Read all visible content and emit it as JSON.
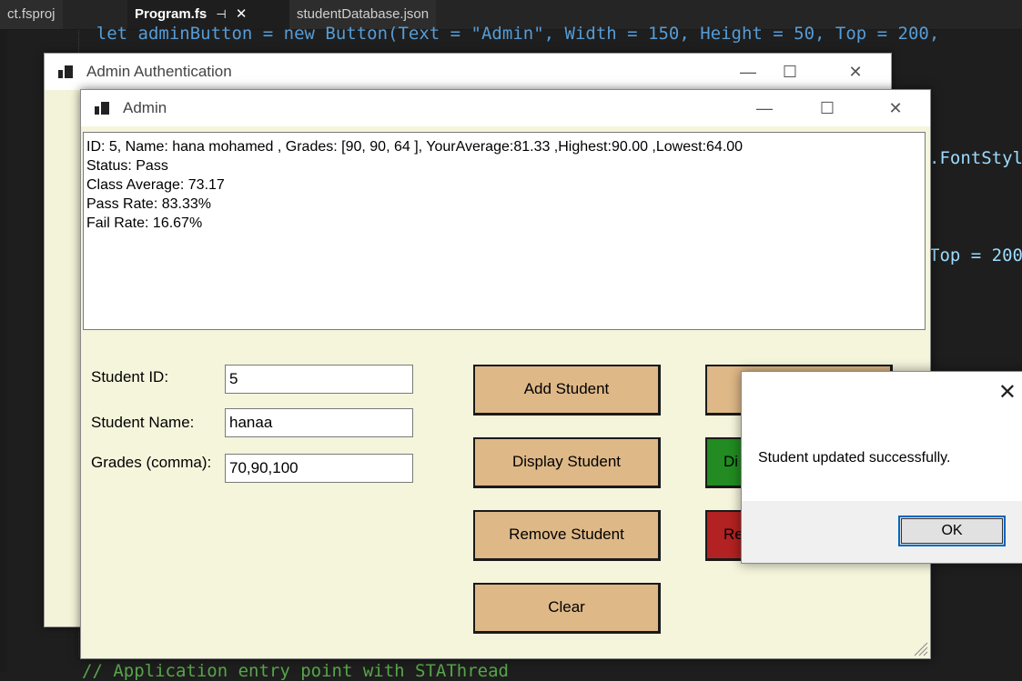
{
  "editor": {
    "tabs": [
      {
        "label": "ct.fsproj"
      },
      {
        "label": "Program.fs",
        "pin": "⊣",
        "close": "✕"
      },
      {
        "label": "studentDatabase.json"
      }
    ],
    "code_top": "    let adminButton = new Button(Text = \"Admin\", Width = 150, Height = 50, Top = 200,",
    "code_right_1": ".FontStyl",
    "code_right_2": "Top = 200",
    "code_bottom": "// Application entry point with STAThread"
  },
  "auth_window": {
    "title": "Admin Authentication",
    "minimize": "—",
    "maximize": "☐",
    "close": "✕"
  },
  "admin_window": {
    "title": "Admin",
    "minimize": "—",
    "maximize": "☐",
    "close": "✕",
    "output": "ID: 5, Name: hana mohamed , Grades: [90, 90, 64 ], YourAverage:81.33 ,Highest:90.00 ,Lowest:64.00\nStatus: Pass\nClass Average: 73.17\nPass Rate: 83.33%\nFail Rate: 16.67%",
    "labels": {
      "student_id": "Student ID:",
      "student_name": "Student Name:",
      "grades": "Grades (comma):"
    },
    "inputs": {
      "student_id": "5",
      "student_name": "hanaa",
      "grades": "70,90,100"
    },
    "buttons": {
      "add": "Add Student",
      "display": "Display Student",
      "remove": "Remove Student",
      "clear": "Clear",
      "green_partial": "Di",
      "red_partial": "Re"
    }
  },
  "message_box": {
    "close": "✕",
    "message": "Student updated successfully.",
    "ok": "OK"
  },
  "colors": {
    "button": "#deb887",
    "green_button": "#228b22",
    "red_button": "#b22222",
    "form_bg": "#f5f5dc"
  }
}
